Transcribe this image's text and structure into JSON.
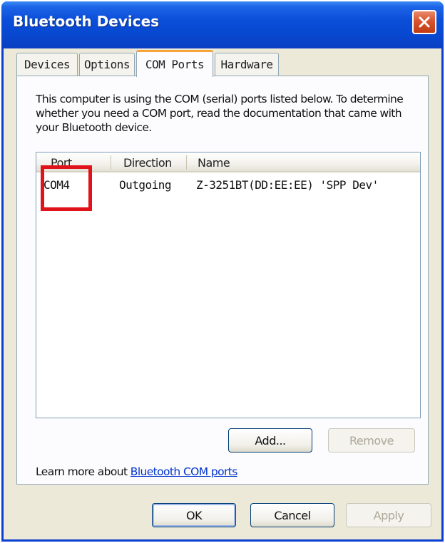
{
  "window": {
    "title": "Bluetooth Devices",
    "close_icon": "close-x-icon"
  },
  "tabs": [
    {
      "label": "Devices",
      "active": false
    },
    {
      "label": "Options",
      "active": false
    },
    {
      "label": "COM Ports",
      "active": true
    },
    {
      "label": "Hardware",
      "active": false
    }
  ],
  "panel": {
    "description": "This computer is using the COM (serial) ports listed below. To determine whether you need a COM port, read the documentation that came with your Bluetooth device.",
    "list": {
      "columns": [
        "Port",
        "Direction",
        "Name"
      ],
      "rows": [
        {
          "port": "COM4",
          "direction": "Outgoing",
          "name": "Z-3251BT(DD:EE:EE) 'SPP Dev'"
        }
      ]
    },
    "add_label": "Add...",
    "remove_label": "Remove",
    "learn_more_prefix": "Learn more about",
    "learn_more_link": "Bluetooth COM ports"
  },
  "footer": {
    "ok_label": "OK",
    "cancel_label": "Cancel",
    "apply_label": "Apply"
  },
  "colors": {
    "titlebar": "#0a4ed8",
    "highlight": "#e0131b",
    "active_tab_accent": "#f5a33a"
  }
}
